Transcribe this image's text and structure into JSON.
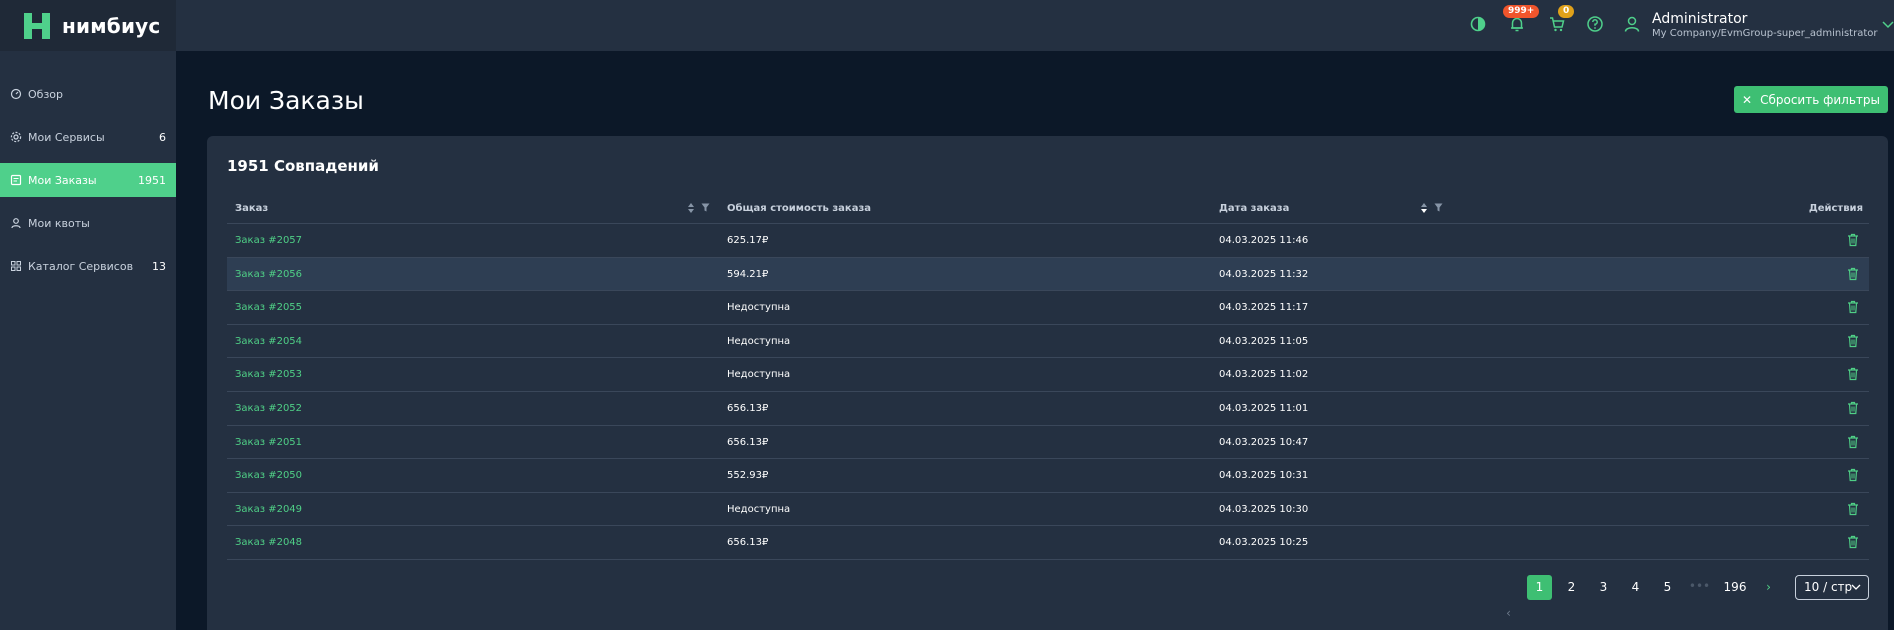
{
  "brand": {
    "name": "нимбиус",
    "color": "#4fd08b"
  },
  "sidebar": {
    "items": [
      {
        "label": "Обзор",
        "count": "",
        "icon": "dashboard-icon"
      },
      {
        "label": "Мои Сервисы",
        "count": "6",
        "icon": "gear-icon"
      },
      {
        "label": "Мои Заказы",
        "count": "1951",
        "icon": "document-icon",
        "active": true
      },
      {
        "label": "Мои квоты",
        "count": "",
        "icon": "user-icon"
      },
      {
        "label": "Каталог Сервисов",
        "count": "13",
        "icon": "grid-icon"
      }
    ]
  },
  "topbar": {
    "notifications_badge": "999+",
    "cart_badge": "0",
    "user_name": "Administrator",
    "user_company": "My Company/EvmGroup-super_administrator"
  },
  "page": {
    "title": "Мои Заказы",
    "reset_filters_label": "Сбросить фильтры",
    "matches": "1951 Совпадений"
  },
  "table": {
    "columns": {
      "order": "Заказ",
      "cost": "Общая стоимость заказа",
      "date": "Дата заказа",
      "actions": "Действия"
    },
    "rows": [
      {
        "order": "Заказ #2057",
        "cost": "625.17₽",
        "date": "04.03.2025 11:46"
      },
      {
        "order": "Заказ #2056",
        "cost": "594.21₽",
        "date": "04.03.2025 11:32"
      },
      {
        "order": "Заказ #2055",
        "cost": "Недоступна",
        "date": "04.03.2025 11:17"
      },
      {
        "order": "Заказ #2054",
        "cost": "Недоступна",
        "date": "04.03.2025 11:05"
      },
      {
        "order": "Заказ #2053",
        "cost": "Недоступна",
        "date": "04.03.2025 11:02"
      },
      {
        "order": "Заказ #2052",
        "cost": "656.13₽",
        "date": "04.03.2025 11:01"
      },
      {
        "order": "Заказ #2051",
        "cost": "656.13₽",
        "date": "04.03.2025 10:47"
      },
      {
        "order": "Заказ #2050",
        "cost": "552.93₽",
        "date": "04.03.2025 10:31"
      },
      {
        "order": "Заказ #2049",
        "cost": "Недоступна",
        "date": "04.03.2025 10:30"
      },
      {
        "order": "Заказ #2048",
        "cost": "656.13₽",
        "date": "04.03.2025 10:25"
      }
    ]
  },
  "pagination": {
    "pages": [
      "1",
      "2",
      "3",
      "4",
      "5"
    ],
    "ellipsis": "•••",
    "last_page": "196",
    "current": "1",
    "page_size": "10 / стр"
  }
}
